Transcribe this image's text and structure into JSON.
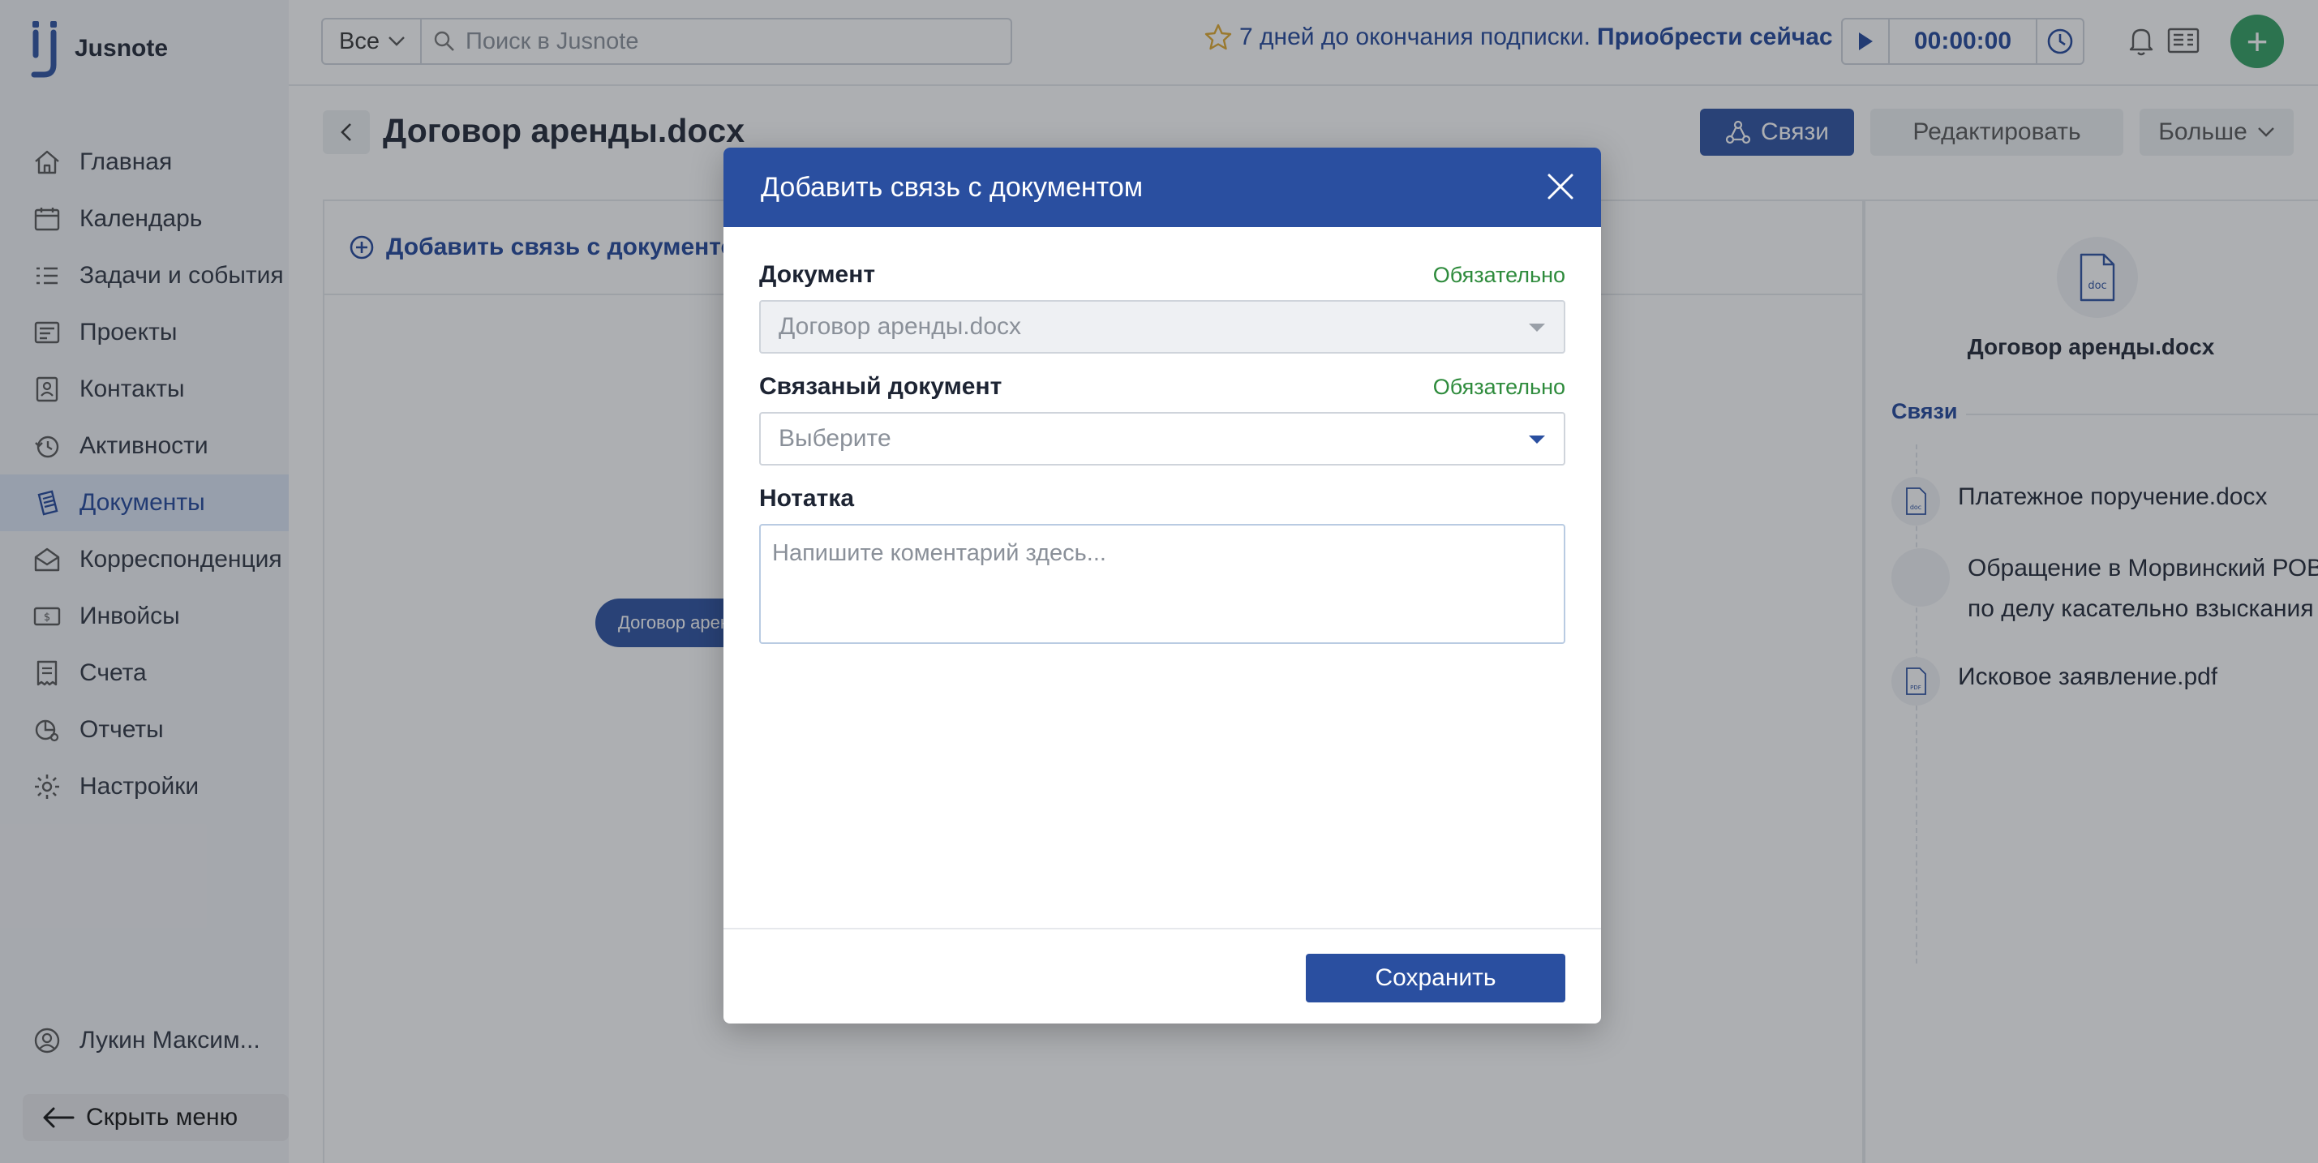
{
  "app": {
    "name": "Jusnote"
  },
  "sidebar": {
    "items": [
      {
        "label": "Главная",
        "icon": "home-icon"
      },
      {
        "label": "Календарь",
        "icon": "calendar-icon"
      },
      {
        "label": "Задачи и события",
        "icon": "tasks-icon"
      },
      {
        "label": "Проекты",
        "icon": "projects-icon"
      },
      {
        "label": "Контакты",
        "icon": "contacts-icon"
      },
      {
        "label": "Активности",
        "icon": "activity-icon"
      },
      {
        "label": "Документы",
        "icon": "documents-icon",
        "active": true
      },
      {
        "label": "Корреспонденция",
        "icon": "correspondence-icon"
      },
      {
        "label": "Инвойсы",
        "icon": "invoice-icon"
      },
      {
        "label": "Счета",
        "icon": "accounts-icon"
      },
      {
        "label": "Отчеты",
        "icon": "reports-icon"
      },
      {
        "label": "Настройки",
        "icon": "settings-icon"
      }
    ],
    "user_name": "Лукин Максим...",
    "hide_menu_label": "Скрыть меню"
  },
  "topbar": {
    "filter_value": "Все",
    "search_placeholder": "Поиск в Jusnote",
    "subscription_notice": "7 дней до окончания подписки.",
    "subscription_link": "Приобрести сейчас",
    "timer_value": "00:00:00",
    "add_label": "+"
  },
  "document": {
    "title": "Договор аренды.docx",
    "links_button": "Связи",
    "edit_button": "Редактировать",
    "more_button": "Больше",
    "add_link_label": "Добавить связь с документом",
    "graph_node_label": "Договор аренды.docx"
  },
  "right_panel": {
    "icon_label": "doc",
    "title": "Договор аренды.docx",
    "section_title": "Связи",
    "items": [
      {
        "name": "Платежное поручение.docx",
        "icon_label": "doc"
      },
      {
        "name": "Обращение в Морвинский РОВД по делу касательно взыскания",
        "line1": "Обращение в Морвинский РОВД",
        "line2": "по делу касательно взыскания"
      },
      {
        "name": "Исковое заявление.pdf",
        "icon_label": "PDF"
      }
    ]
  },
  "modal": {
    "title": "Добавить связь с документом",
    "required_label": "Обязательно",
    "document_label": "Документ",
    "document_value": "Договор аренды.docx",
    "related_label": "Связаный документ",
    "related_placeholder": "Выберите",
    "note_label": "Нотатка",
    "note_placeholder": "Напишите коментарий здесь...",
    "save_button": "Сохранить"
  },
  "colors": {
    "brand_blue": "#2a4fa0",
    "required_green": "#2e8b3c",
    "add_green": "#2f9e5f",
    "star": "#e0a92b"
  }
}
